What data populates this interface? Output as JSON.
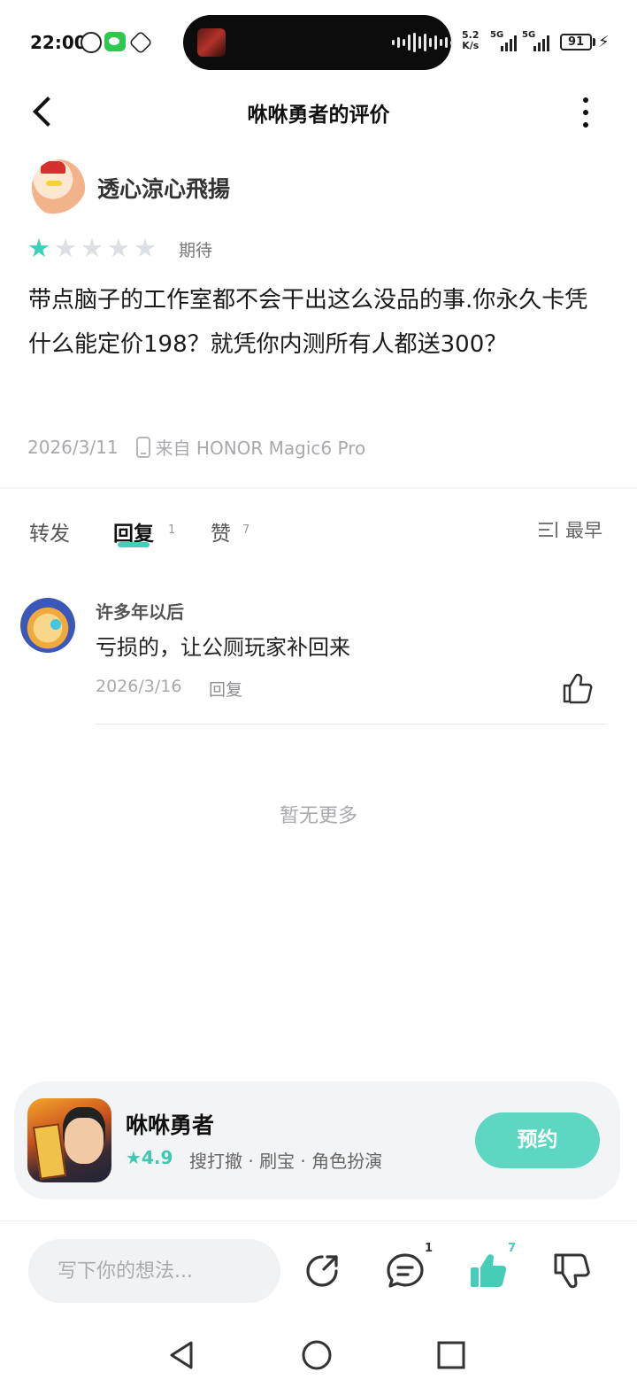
{
  "status_bar": {
    "time": "22:00",
    "net_speed_value": "5.2",
    "net_speed_unit": "K/s",
    "signal_1": "5G",
    "signal_2": "5G",
    "battery": "91",
    "icons": [
      "alarm-icon",
      "wechat-icon",
      "hand-icon",
      "charging-icon"
    ]
  },
  "header": {
    "title": "咻咻勇者的评价"
  },
  "review": {
    "author": "透心涼心飛揚",
    "rating": 1,
    "rating_max": 5,
    "rating_label": "期待",
    "text": "带点脑子的工作室都不会干出这么没品的事.你永久卡凭什么能定价198？就凭你内测所有人都送300？",
    "date": "2026/3/11",
    "device": "来自 HONOR Magic6 Pro"
  },
  "tabs": {
    "forward": "转发",
    "reply": "回复",
    "reply_count": "1",
    "like": "赞",
    "like_count": "7",
    "sort": "最早"
  },
  "comments": [
    {
      "user": "许多年以后",
      "text": "亏损的，让公厕玩家补回来",
      "date": "2026/3/16",
      "reply_label": "回复"
    }
  ],
  "no_more": "暂无更多",
  "game_card": {
    "name": "咻咻勇者",
    "rating": "4.9",
    "tags": "搜打撤 · 刷宝 · 角色扮演",
    "button": "预约"
  },
  "bottom_bar": {
    "placeholder": "写下你的想法...",
    "comment_count": "1",
    "like_count": "7"
  },
  "colors": {
    "accent": "#46cdb8",
    "reserve_button": "#5dd6c2",
    "star_empty": "#dcdfe3"
  }
}
